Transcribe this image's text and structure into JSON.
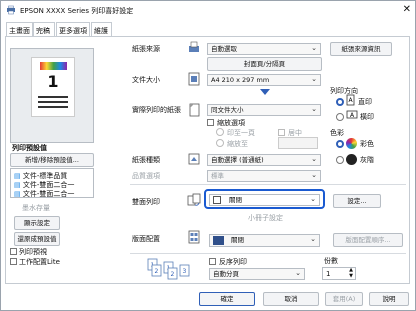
{
  "window": {
    "title": "EPSON XXXX Series 列印喜好設定",
    "close_glyph": "✕"
  },
  "tabs": [
    "主畫面",
    "完稿",
    "更多選項",
    "維護"
  ],
  "preview": {
    "page_number": "1"
  },
  "presets": {
    "title": "列印預設值",
    "add_remove_button": "新增/移除預設值...",
    "items": [
      "文件-標準品質",
      "文件-雙面二合一",
      "文件-雙面二合一"
    ],
    "ink_levels_link": "墨水存量",
    "show_settings_button": "顯示設定",
    "reset_defaults_button": "還原成預設值",
    "print_preview_label": "列印預視",
    "job_arranger_label": "工作配置Lite"
  },
  "main": {
    "paper_source_label": "紙張來源",
    "paper_source_value": "自動選取",
    "paper_source_info_button": "紙張來源資訊",
    "envelope_button": "封面頁/分隔頁",
    "document_size_label": "文件大小",
    "document_size_value": "A4 210 x 297 mm",
    "output_paper_label": "實際列印的紙張",
    "output_paper_value": "同文件大小",
    "reduce_enlarge_label": "縮放選項",
    "fit_to_page_label": "印至一頁",
    "center_label": "居中",
    "zoom_label": "縮放至",
    "paper_type_label": "紙張種類",
    "paper_type_value": "自動選擇 (普通紙)",
    "quality_label": "品質選項",
    "quality_value": "標準",
    "orientation_label": "列印方向",
    "portrait_label": "直印",
    "landscape_label": "橫印",
    "color_label": "色彩",
    "color_value_label": "彩色",
    "grayscale_label": "灰階",
    "duplex_label": "雙面列印",
    "duplex_value": "關閉",
    "duplex_settings_button": "設定...",
    "booklet_label": "小冊子設定",
    "multipage_label": "版面配置",
    "multipage_value": "關閉",
    "layout_order_button": "版面配置順序...",
    "reverse_order_label": "反序列印",
    "collate_value": "自動分頁",
    "copies_label": "份數",
    "copies_value": "1"
  },
  "footer": {
    "ok": "確定",
    "cancel": "取消",
    "apply": "套用(A)",
    "help": "說明"
  },
  "colors": {
    "accent": "#2f5fb7",
    "duplex_highlight": "#1a5ad1"
  }
}
